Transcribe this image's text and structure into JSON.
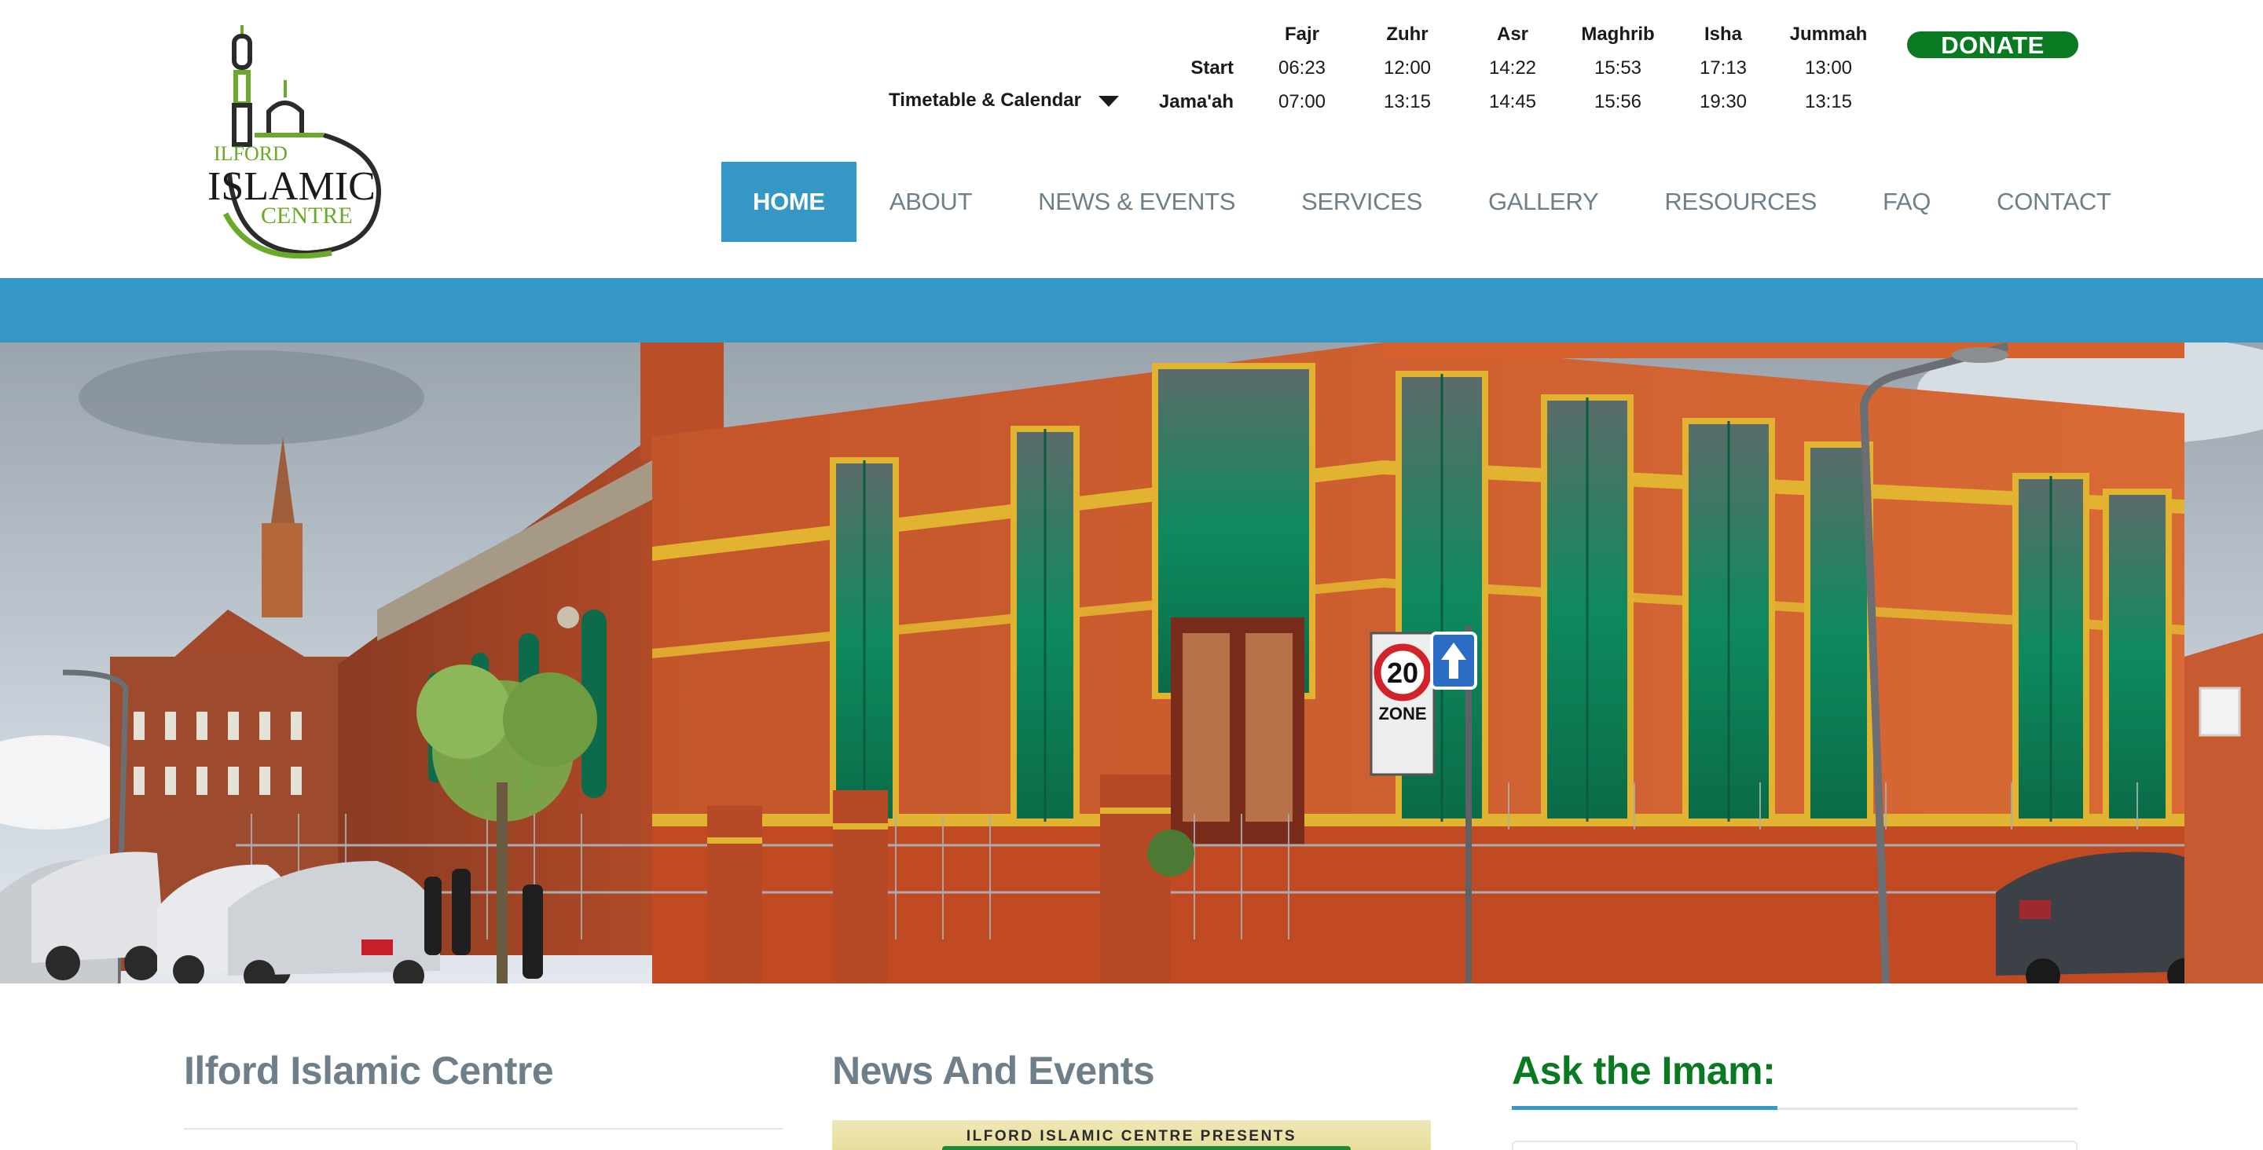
{
  "brand": {
    "logo_top": "ILFORD",
    "logo_mid": "ISLAMIC",
    "logo_bottom": "CENTRE"
  },
  "timetable": {
    "link_label": "Timetable & Calendar",
    "columns": [
      "Fajr",
      "Zuhr",
      "Asr",
      "Maghrib",
      "Isha",
      "Jummah"
    ],
    "rows": [
      {
        "label": "Start",
        "times": [
          "06:23",
          "12:00",
          "14:22",
          "15:53",
          "17:13",
          "13:00"
        ]
      },
      {
        "label": "Jama'ah",
        "times": [
          "07:00",
          "13:15",
          "14:45",
          "15:56",
          "19:30",
          "13:15"
        ]
      }
    ]
  },
  "donate_label": "DONATE",
  "nav": {
    "items": [
      {
        "label": "HOME",
        "active": true
      },
      {
        "label": "ABOUT",
        "active": false
      },
      {
        "label": "NEWS & EVENTS",
        "active": false
      },
      {
        "label": "SERVICES",
        "active": false
      },
      {
        "label": "GALLERY",
        "active": false
      },
      {
        "label": "RESOURCES",
        "active": false
      },
      {
        "label": "FAQ",
        "active": false
      },
      {
        "label": "CONTACT",
        "active": false
      }
    ]
  },
  "hero": {
    "sign_number": "20",
    "sign_zone": "ZONE"
  },
  "sections": {
    "col1_title": "Ilford Islamic Centre",
    "col2_title": "News And Events",
    "col2_poster_text": "ILFORD ISLAMIC CENTRE PRESENTS",
    "col3_title": "Ask the Imam:"
  },
  "colors": {
    "accent_blue": "#3597c6",
    "donate_green": "#0a7a22",
    "nav_grey": "#6f7f8a",
    "brick": "#c4552b",
    "window_green": "#0e8a5e"
  }
}
